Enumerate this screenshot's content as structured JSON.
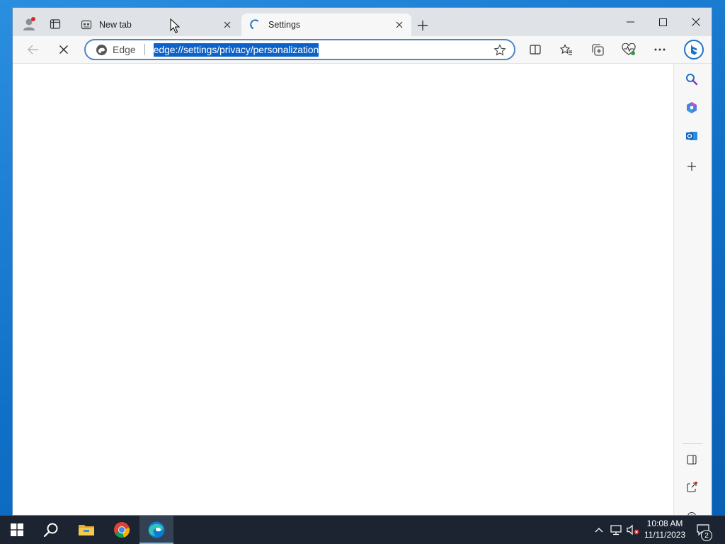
{
  "browser": {
    "tabs": [
      {
        "label": "New tab",
        "active": false,
        "icon": "new-tab-page-icon"
      },
      {
        "label": "Settings",
        "active": true,
        "icon": "loading-spinner-icon"
      }
    ],
    "address_bar": {
      "brand_label": "Edge",
      "url": "edge://settings/privacy/personalization",
      "url_selected": true
    },
    "toolbar_icons": [
      "back-arrow-icon",
      "stop-loading-icon",
      "split-screen-icon",
      "favorites-icon",
      "collections-icon",
      "browser-essentials-icon",
      "more-menu-icon",
      "bing-chat-icon"
    ],
    "sidebar_icons": [
      "search-icon",
      "copilot-icon",
      "outlook-icon",
      "add-icon",
      "hide-sidebar-icon",
      "external-link-icon",
      "settings-gear-icon"
    ]
  },
  "taskbar": {
    "apps": [
      "start-icon",
      "search-icon",
      "file-explorer-icon",
      "chrome-icon",
      "edge-icon"
    ],
    "active_app": "edge-icon",
    "clock": {
      "time": "10:08 AM",
      "date": "11/11/2023"
    },
    "notifications_count": "2"
  },
  "colors": {
    "accent": "#0b62c9",
    "taskbar": "#1b2430",
    "desktop": "#0f6fc6"
  }
}
